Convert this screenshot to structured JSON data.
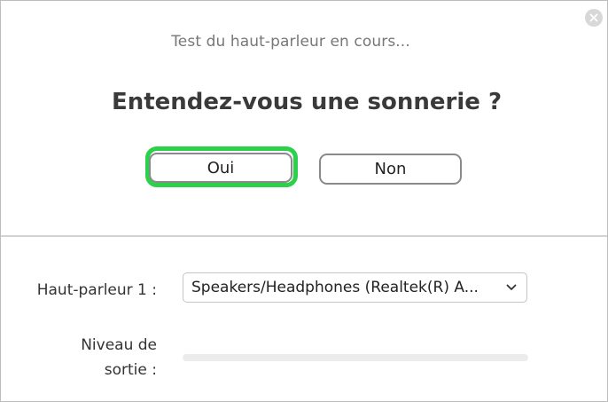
{
  "dialog": {
    "status_text": "Test du haut-parleur en cours...",
    "question": "Entendez-vous une sonnerie ?",
    "yes_label": "Oui",
    "no_label": "Non",
    "focused_button": "yes",
    "focus_color": "#2bd14a",
    "close_icon": "close-icon"
  },
  "settings": {
    "speaker_label": "Haut-parleur 1 :",
    "speaker_value": "Speakers/Headphones (Realtek(R) A...",
    "speaker_dropdown_icon": "chevron-down-icon",
    "output_level_label_line1": "Niveau de",
    "output_level_label_line2": "sortie :",
    "output_level": 0
  }
}
